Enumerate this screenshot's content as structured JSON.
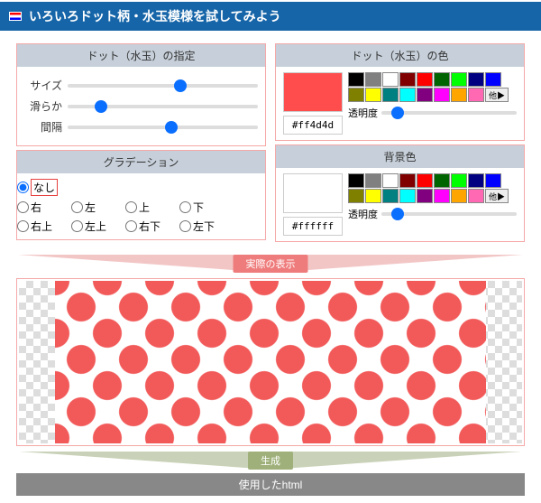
{
  "title": "いろいろドット柄・水玉模様を試してみよう",
  "panels": {
    "dotSpec": {
      "title": "ドット（水玉）の指定",
      "size_label": "サイズ",
      "smooth_label": "滑らか",
      "gap_label": "間隔"
    },
    "gradient": {
      "title": "グラデーション",
      "options": [
        "なし",
        "右",
        "左",
        "上",
        "下",
        "右上",
        "左上",
        "右下",
        "左下"
      ],
      "selected": "なし"
    },
    "dotColor": {
      "title": "ドット（水玉）の色",
      "hex": "#ff4d4d",
      "opacity_label": "透明度",
      "more_label": "他▶"
    },
    "bgColor": {
      "title": "背景色",
      "hex": "#ffffff",
      "opacity_label": "透明度",
      "more_label": "他▶"
    }
  },
  "palette": [
    "#000000",
    "#808080",
    "#ffffff",
    "#800000",
    "#ff0000",
    "#006400",
    "#00ff00",
    "#000080",
    "#0000ff",
    "#808000",
    "#ffff00",
    "#008080",
    "#00ffff",
    "#800080",
    "#ff00ff",
    "#ffa500",
    "#ff69b4"
  ],
  "sliders": {
    "size": 60,
    "smooth": 15,
    "gap": 55,
    "dot_opacity": 8,
    "bg_opacity": 8
  },
  "bands": {
    "preview": "実際の表示",
    "generate": "生成",
    "html": "使用したhtml"
  },
  "colors": {
    "dot": "#ff4d4d",
    "bg": "#ffffff"
  }
}
